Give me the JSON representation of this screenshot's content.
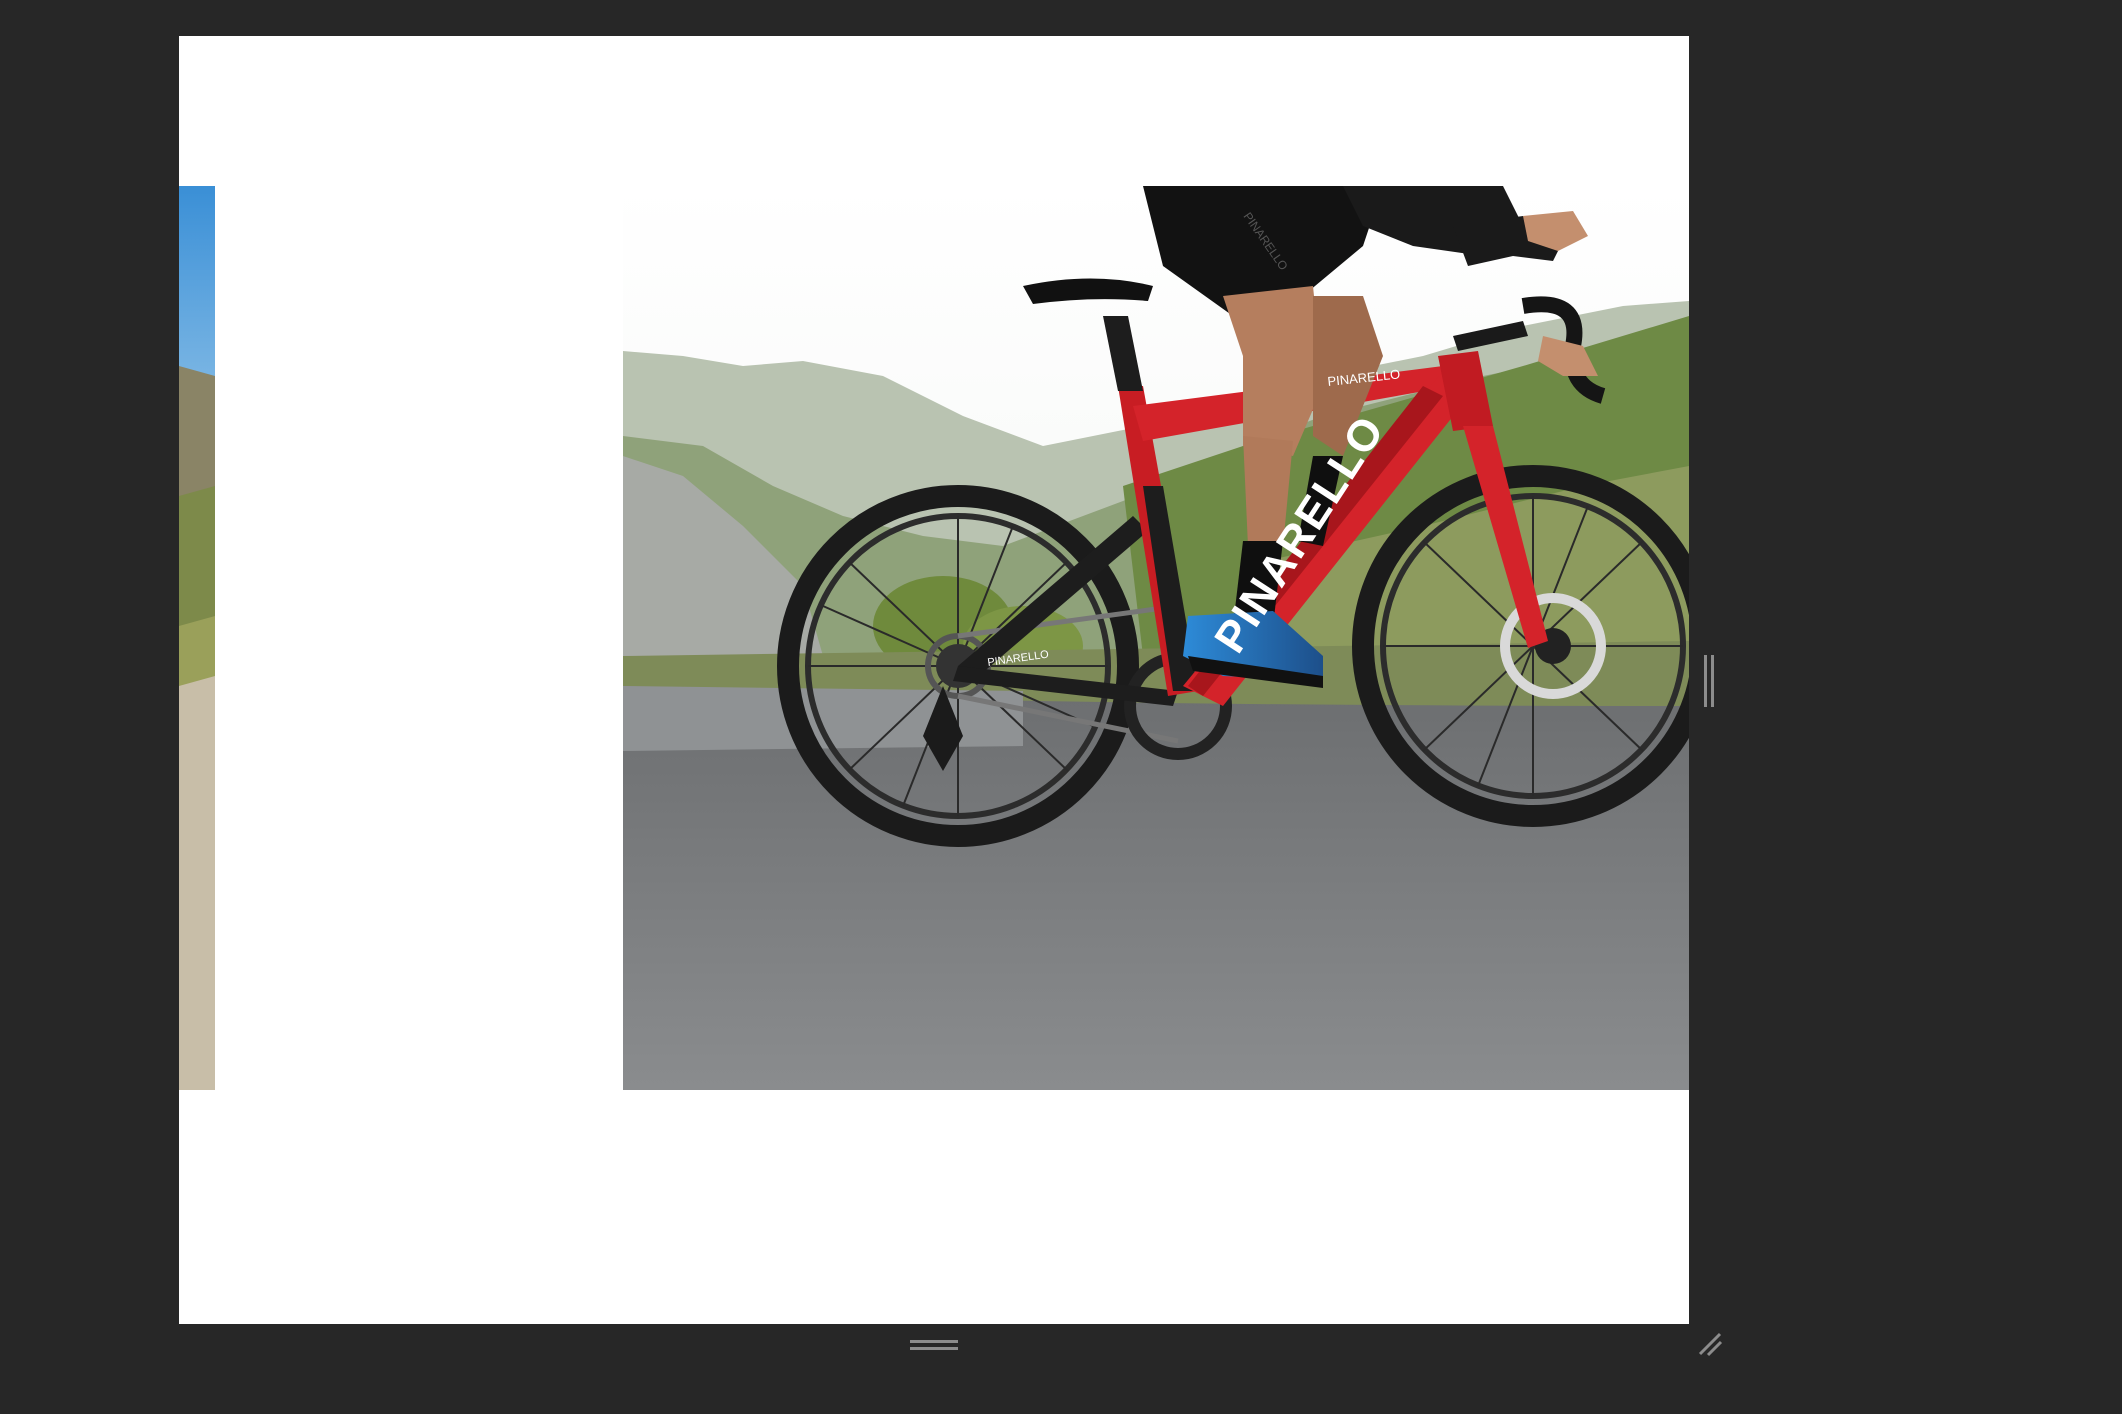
{
  "viewer": {
    "background_color": "#272727",
    "canvas_color": "#ffffff",
    "handle_color": "#8c8c8c"
  },
  "slides": {
    "previous": {
      "icon": "landscape-photo-partial",
      "sky_color": "#3f95d8"
    },
    "current": {
      "icon": "cyclist-road-bike-photo",
      "frame_color": "#d4232a",
      "downtube_text": "PINARELLO",
      "toptube_text": "PINARELLO",
      "seatstay_text": "PINARELLO",
      "shorts_text": "PINARELLO"
    }
  },
  "controls": {
    "right_handle_icon": "resize-vertical-bars-icon",
    "bottom_handle_icon": "resize-horizontal-bars-icon",
    "corner_handle_icon": "resize-corner-icon"
  }
}
